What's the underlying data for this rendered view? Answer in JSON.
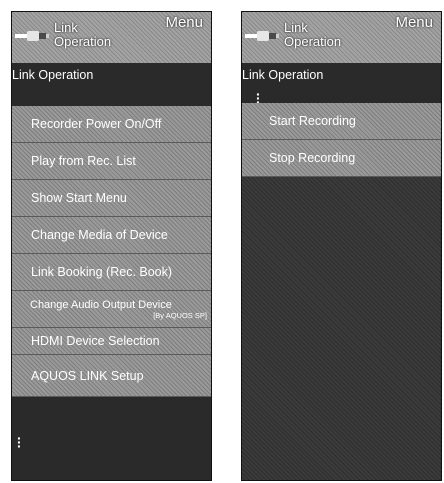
{
  "left_panel": {
    "header": {
      "title_line1": "Link",
      "title_line2": "Operation",
      "menu": "Menu"
    },
    "subtitle": "Link Operation",
    "items": [
      "Recorder Power On/Off",
      "Play from Rec. List",
      "Show Start Menu",
      "Change Media of Device",
      "Link Booking (Rec. Book)",
      {
        "main": "Change Audio Output Device",
        "sub": "[By AQUOS SP]"
      },
      "HDMI Device Selection",
      "AQUOS LINK Setup"
    ]
  },
  "right_panel": {
    "header": {
      "title_line1": "Link",
      "title_line2": "Operation",
      "menu": "Menu"
    },
    "subtitle": "Link Operation",
    "items": [
      "Start Recording",
      "Stop Recording"
    ]
  },
  "colors": {
    "panel_bg": "#2a2a2a",
    "item_bg": "#8c8c8c",
    "header_bg": "#999999",
    "text": "#ffffff"
  },
  "icons": {
    "connector": "cable-connector-icon",
    "more": "vertical-ellipsis-icon"
  }
}
